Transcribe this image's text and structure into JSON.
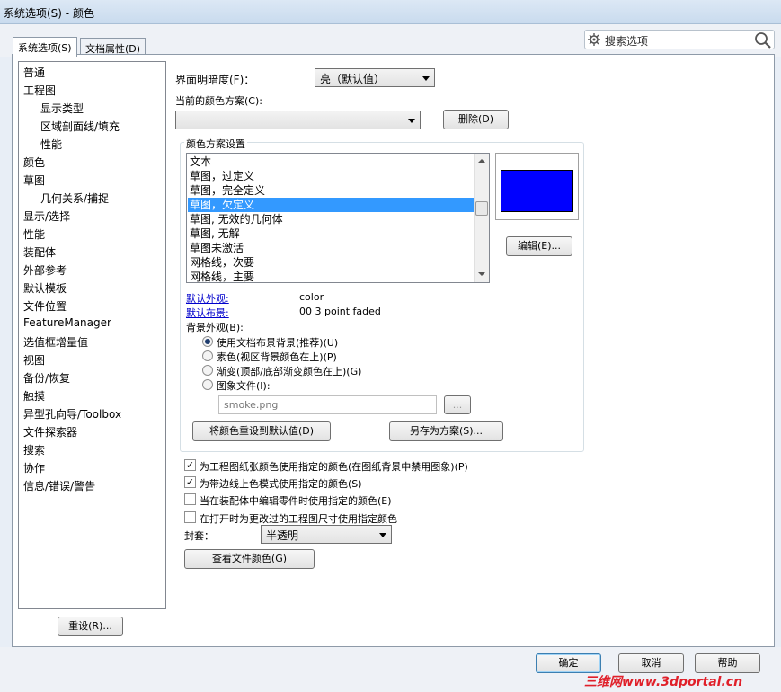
{
  "window": {
    "title": "系统选项(S) - 颜色"
  },
  "tabs": [
    {
      "label": "系统选项(S)",
      "active": true
    },
    {
      "label": "文档属性(D)",
      "active": false
    }
  ],
  "search": {
    "placeholder": "搜索选项",
    "icon_left": "gear-icon",
    "icon_right": "magnifier-icon"
  },
  "tree": {
    "items": [
      {
        "label": "普通",
        "level": 0
      },
      {
        "label": "工程图",
        "level": 0
      },
      {
        "label": "显示类型",
        "level": 1
      },
      {
        "label": "区域剖面线/填充",
        "level": 1
      },
      {
        "label": "性能",
        "level": 1
      },
      {
        "label": "颜色",
        "level": 0
      },
      {
        "label": "草图",
        "level": 0
      },
      {
        "label": "几何关系/捕捉",
        "level": 1
      },
      {
        "label": "显示/选择",
        "level": 0
      },
      {
        "label": "性能",
        "level": 0
      },
      {
        "label": "装配体",
        "level": 0
      },
      {
        "label": "外部参考",
        "level": 0
      },
      {
        "label": "默认模板",
        "level": 0
      },
      {
        "label": "文件位置",
        "level": 0
      },
      {
        "label": "FeatureManager",
        "level": 0
      },
      {
        "label": "选值框增量值",
        "level": 0
      },
      {
        "label": "视图",
        "level": 0
      },
      {
        "label": "备份/恢复",
        "level": 0
      },
      {
        "label": "触摸",
        "level": 0
      },
      {
        "label": "异型孔向导/Toolbox",
        "level": 0
      },
      {
        "label": "文件探索器",
        "level": 0
      },
      {
        "label": "搜索",
        "level": 0
      },
      {
        "label": "协作",
        "level": 0
      },
      {
        "label": "信息/错误/警告",
        "level": 0
      }
    ],
    "reset_label": "重设(R)..."
  },
  "brightness": {
    "label": "界面明暗度(F)：",
    "value": "亮（默认值）"
  },
  "scheme": {
    "label": "当前的颜色方案(C):",
    "value": "",
    "delete_label": "删除(D)"
  },
  "scheme_settings": {
    "group_label": "颜色方案设置",
    "items": [
      "文本",
      "草图，过定义",
      "草图，完全定义",
      "草图，欠定义",
      "草图, 无效的几何体",
      "草图, 无解",
      "草图未激活",
      "网格线，次要",
      "网格线，主要"
    ],
    "selected_index": 3,
    "preview_color": "#0000ff",
    "edit_label": "编辑(E)...",
    "default_appearance_label": "默认外观:",
    "default_appearance_value": "color",
    "default_scene_label": "默认布景:",
    "default_scene_value": "00 3 point faded",
    "background_label": "背景外观(B):",
    "background_options": [
      {
        "label": "使用文档布景背景(推荐)(U)",
        "checked": true
      },
      {
        "label": "素色(视区背景颜色在上)(P)",
        "checked": false
      },
      {
        "label": "渐变(顶部/底部渐变颜色在上)(G)",
        "checked": false
      },
      {
        "label": "图象文件(I):",
        "checked": false
      }
    ],
    "image_file_value": "smoke.png",
    "browse_label": "...",
    "reset_defaults_label": "将颜色重设到默认值(D)",
    "save_as_label": "另存为方案(S)..."
  },
  "checkboxes": [
    {
      "label": "为工程图纸张颜色使用指定的颜色(在图纸背景中禁用图象)(P)",
      "checked": true
    },
    {
      "label": "为带边线上色模式使用指定的颜色(S)",
      "checked": true
    },
    {
      "label": "当在装配体中编辑零件时使用指定的颜色(E)",
      "checked": false
    },
    {
      "label": "在打开时为更改过的工程图尺寸使用指定颜色",
      "checked": false
    }
  ],
  "envelope": {
    "label": "封套：",
    "value": "半透明"
  },
  "view_doc_colors_label": "查看文件颜色(G)",
  "footer": {
    "ok_label": "确定",
    "cancel_label": "取消",
    "help_label": "帮助"
  },
  "watermark": "三维网www.3dportal.cn"
}
